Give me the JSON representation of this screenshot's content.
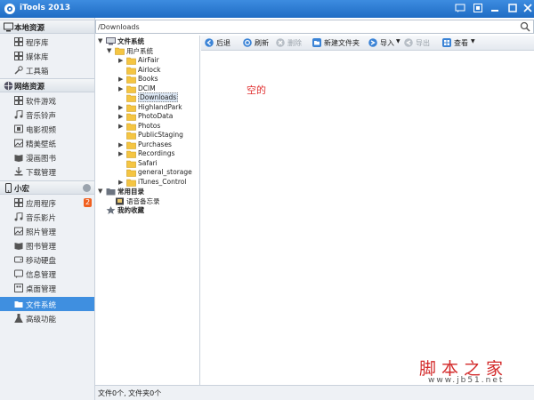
{
  "app": {
    "title": "iTools 2013"
  },
  "colors": {
    "accent": "#3f8fe0",
    "titlebar": "#2a7bd3",
    "badge": "#f06020",
    "empty_text": "#e03030",
    "watermark": "#d32a2a"
  },
  "sidebar": {
    "sections": [
      {
        "label": "本地资源",
        "icon": "computer-icon",
        "items": [
          {
            "label": "程序库",
            "icon": "grid-icon"
          },
          {
            "label": "媒体库",
            "icon": "grid-icon"
          },
          {
            "label": "工具箱",
            "icon": "wrench-icon"
          }
        ]
      },
      {
        "label": "网络资源",
        "icon": "globe-icon",
        "items": [
          {
            "label": "软件游戏",
            "icon": "grid-icon"
          },
          {
            "label": "音乐铃声",
            "icon": "music-icon"
          },
          {
            "label": "电影视频",
            "icon": "film-icon"
          },
          {
            "label": "精美壁纸",
            "icon": "picture-icon"
          },
          {
            "label": "漫画图书",
            "icon": "book-icon"
          },
          {
            "label": "下载管理",
            "icon": "download-icon"
          }
        ]
      },
      {
        "label": "小宏",
        "icon": "phone-icon",
        "items": [
          {
            "label": "应用程序",
            "icon": "grid-icon",
            "badge": "2"
          },
          {
            "label": "音乐影片",
            "icon": "music-icon"
          },
          {
            "label": "照片管理",
            "icon": "picture-icon"
          },
          {
            "label": "图书管理",
            "icon": "book-icon"
          },
          {
            "label": "移动硬盘",
            "icon": "disk-icon"
          },
          {
            "label": "信息管理",
            "icon": "message-icon"
          },
          {
            "label": "桌面管理",
            "icon": "desktop-icon"
          },
          {
            "label": "文件系统",
            "icon": "folder-icon",
            "active": true
          },
          {
            "label": "高级功能",
            "icon": "flask-icon"
          }
        ]
      }
    ]
  },
  "pathbar": {
    "value": "/Downloads"
  },
  "tree": {
    "root": "文件系统",
    "user_system": "用户系统",
    "folders": [
      "AirFair",
      "Airlock",
      "Books",
      "DCIM",
      "Downloads",
      "HighlandPark",
      "PhotoData",
      "Photos",
      "PublicStaging",
      "Purchases",
      "Recordings",
      "Safari",
      "general_storage",
      "iTunes_Control"
    ],
    "selected": "Downloads",
    "common_dir": "常用目录",
    "voice_memo": "语音备忘录",
    "favorites": "我的收藏"
  },
  "toolbar": {
    "back": "后退",
    "refresh": "刷新",
    "delete": "删除",
    "new_folder": "新建文件夹",
    "import": "导入",
    "export": "导出",
    "view": "查看"
  },
  "content": {
    "empty_text": "空的"
  },
  "watermark": {
    "text": "脚本之家",
    "url": "www.jb51.net"
  },
  "status": {
    "text": "文件0个, 文件夹0个"
  }
}
